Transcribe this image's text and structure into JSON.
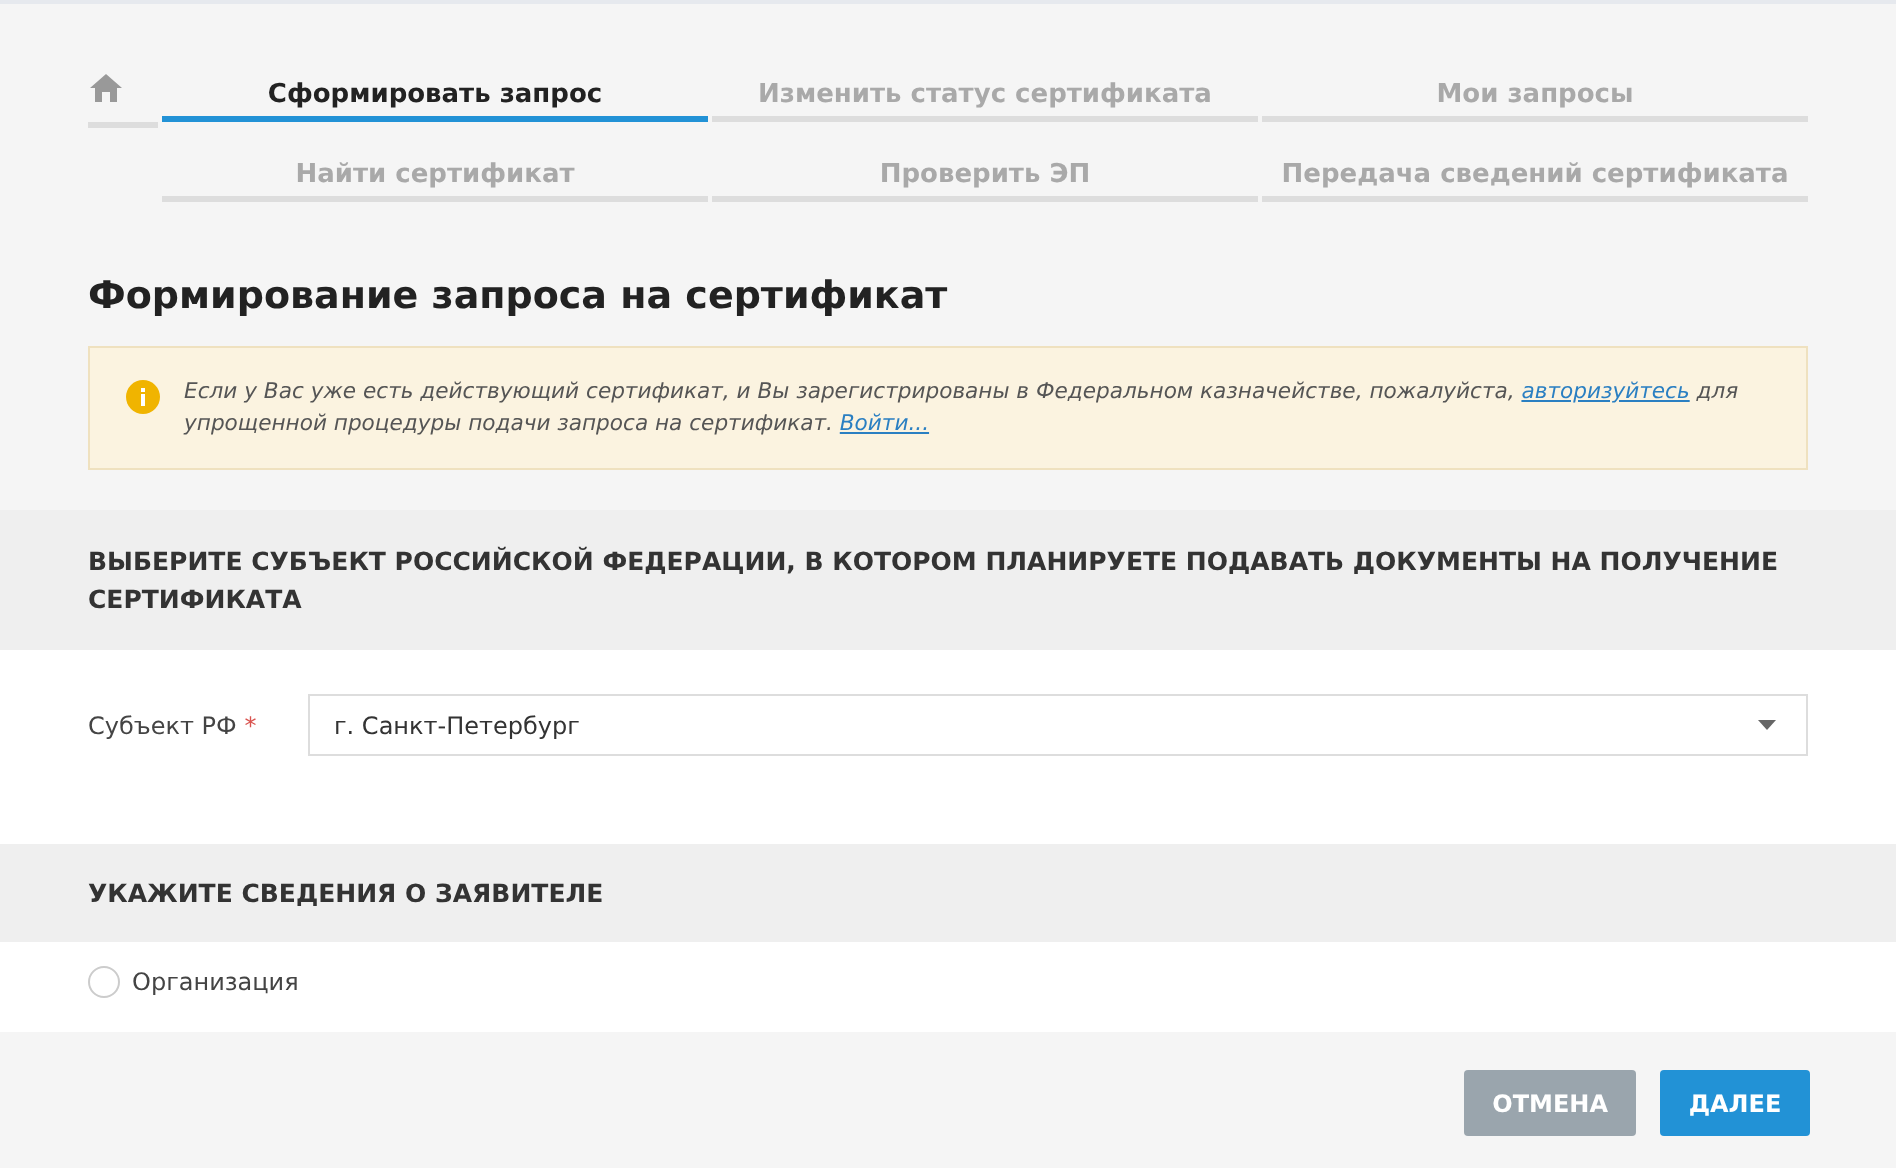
{
  "tabs": [
    {
      "label": "Сформировать запрос",
      "selected": true
    },
    {
      "label": "Изменить статус сертификата",
      "selected": false
    },
    {
      "label": "Мои запросы",
      "selected": false
    },
    {
      "label": "Найти сертификат",
      "selected": false
    },
    {
      "label": "Проверить ЭП",
      "selected": false
    },
    {
      "label": "Передача сведений сертификата",
      "selected": false
    }
  ],
  "page_title": "Формирование запроса на сертификат",
  "notice": {
    "text_before": "Если у Вас уже есть действующий сертификат, и Вы зарегистрированы в Федеральном казначействе, пожалуйста, ",
    "link": "авторизуйтесь",
    "text_after": " для упрощенной процедуры подачи запроса на сертификат. ",
    "login_link": "Войти..."
  },
  "region_section": {
    "heading": "ВЫБЕРИТЕ СУБЪЕКТ РОССИЙСКОЙ ФЕДЕРАЦИИ, В КОТОРОМ ПЛАНИРУЕТЕ ПОДАВАТЬ ДОКУМЕНТЫ НА ПОЛУЧЕНИЕ СЕРТИФИКАТА",
    "label": "Субъект РФ",
    "required_mark": "*",
    "value": "г. Санкт-Петербург"
  },
  "applicant_section": {
    "heading": "УКАЖИТЕ СВЕДЕНИЯ О ЗАЯВИТЕЛЕ",
    "options": [
      {
        "label": "Организация",
        "selected": false
      }
    ]
  },
  "buttons": [
    {
      "label": "ОТМЕНА",
      "kind": "secondary"
    },
    {
      "label": "ДАЛЕЕ",
      "kind": "primary"
    }
  ]
}
